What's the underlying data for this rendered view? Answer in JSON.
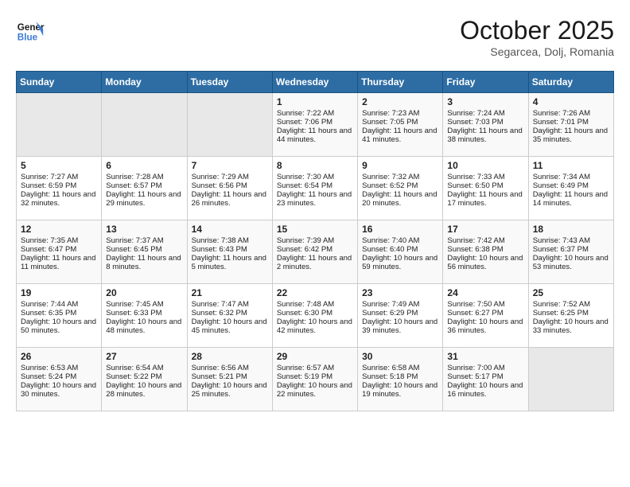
{
  "header": {
    "logo_line1": "General",
    "logo_line2": "Blue",
    "title": "October 2025",
    "subtitle": "Segarcea, Dolj, Romania"
  },
  "weekdays": [
    "Sunday",
    "Monday",
    "Tuesday",
    "Wednesday",
    "Thursday",
    "Friday",
    "Saturday"
  ],
  "weeks": [
    [
      {
        "day": "",
        "empty": true
      },
      {
        "day": "",
        "empty": true
      },
      {
        "day": "",
        "empty": true
      },
      {
        "day": "1",
        "sunrise": "7:22 AM",
        "sunset": "7:06 PM",
        "daylight": "11 hours and 44 minutes."
      },
      {
        "day": "2",
        "sunrise": "7:23 AM",
        "sunset": "7:05 PM",
        "daylight": "11 hours and 41 minutes."
      },
      {
        "day": "3",
        "sunrise": "7:24 AM",
        "sunset": "7:03 PM",
        "daylight": "11 hours and 38 minutes."
      },
      {
        "day": "4",
        "sunrise": "7:26 AM",
        "sunset": "7:01 PM",
        "daylight": "11 hours and 35 minutes."
      }
    ],
    [
      {
        "day": "5",
        "sunrise": "7:27 AM",
        "sunset": "6:59 PM",
        "daylight": "11 hours and 32 minutes."
      },
      {
        "day": "6",
        "sunrise": "7:28 AM",
        "sunset": "6:57 PM",
        "daylight": "11 hours and 29 minutes."
      },
      {
        "day": "7",
        "sunrise": "7:29 AM",
        "sunset": "6:56 PM",
        "daylight": "11 hours and 26 minutes."
      },
      {
        "day": "8",
        "sunrise": "7:30 AM",
        "sunset": "6:54 PM",
        "daylight": "11 hours and 23 minutes."
      },
      {
        "day": "9",
        "sunrise": "7:32 AM",
        "sunset": "6:52 PM",
        "daylight": "11 hours and 20 minutes."
      },
      {
        "day": "10",
        "sunrise": "7:33 AM",
        "sunset": "6:50 PM",
        "daylight": "11 hours and 17 minutes."
      },
      {
        "day": "11",
        "sunrise": "7:34 AM",
        "sunset": "6:49 PM",
        "daylight": "11 hours and 14 minutes."
      }
    ],
    [
      {
        "day": "12",
        "sunrise": "7:35 AM",
        "sunset": "6:47 PM",
        "daylight": "11 hours and 11 minutes."
      },
      {
        "day": "13",
        "sunrise": "7:37 AM",
        "sunset": "6:45 PM",
        "daylight": "11 hours and 8 minutes."
      },
      {
        "day": "14",
        "sunrise": "7:38 AM",
        "sunset": "6:43 PM",
        "daylight": "11 hours and 5 minutes."
      },
      {
        "day": "15",
        "sunrise": "7:39 AM",
        "sunset": "6:42 PM",
        "daylight": "11 hours and 2 minutes."
      },
      {
        "day": "16",
        "sunrise": "7:40 AM",
        "sunset": "6:40 PM",
        "daylight": "10 hours and 59 minutes."
      },
      {
        "day": "17",
        "sunrise": "7:42 AM",
        "sunset": "6:38 PM",
        "daylight": "10 hours and 56 minutes."
      },
      {
        "day": "18",
        "sunrise": "7:43 AM",
        "sunset": "6:37 PM",
        "daylight": "10 hours and 53 minutes."
      }
    ],
    [
      {
        "day": "19",
        "sunrise": "7:44 AM",
        "sunset": "6:35 PM",
        "daylight": "10 hours and 50 minutes."
      },
      {
        "day": "20",
        "sunrise": "7:45 AM",
        "sunset": "6:33 PM",
        "daylight": "10 hours and 48 minutes."
      },
      {
        "day": "21",
        "sunrise": "7:47 AM",
        "sunset": "6:32 PM",
        "daylight": "10 hours and 45 minutes."
      },
      {
        "day": "22",
        "sunrise": "7:48 AM",
        "sunset": "6:30 PM",
        "daylight": "10 hours and 42 minutes."
      },
      {
        "day": "23",
        "sunrise": "7:49 AM",
        "sunset": "6:29 PM",
        "daylight": "10 hours and 39 minutes."
      },
      {
        "day": "24",
        "sunrise": "7:50 AM",
        "sunset": "6:27 PM",
        "daylight": "10 hours and 36 minutes."
      },
      {
        "day": "25",
        "sunrise": "7:52 AM",
        "sunset": "6:25 PM",
        "daylight": "10 hours and 33 minutes."
      }
    ],
    [
      {
        "day": "26",
        "sunrise": "6:53 AM",
        "sunset": "5:24 PM",
        "daylight": "10 hours and 30 minutes."
      },
      {
        "day": "27",
        "sunrise": "6:54 AM",
        "sunset": "5:22 PM",
        "daylight": "10 hours and 28 minutes."
      },
      {
        "day": "28",
        "sunrise": "6:56 AM",
        "sunset": "5:21 PM",
        "daylight": "10 hours and 25 minutes."
      },
      {
        "day": "29",
        "sunrise": "6:57 AM",
        "sunset": "5:19 PM",
        "daylight": "10 hours and 22 minutes."
      },
      {
        "day": "30",
        "sunrise": "6:58 AM",
        "sunset": "5:18 PM",
        "daylight": "10 hours and 19 minutes."
      },
      {
        "day": "31",
        "sunrise": "7:00 AM",
        "sunset": "5:17 PM",
        "daylight": "10 hours and 16 minutes."
      },
      {
        "day": "",
        "empty": true
      }
    ]
  ]
}
